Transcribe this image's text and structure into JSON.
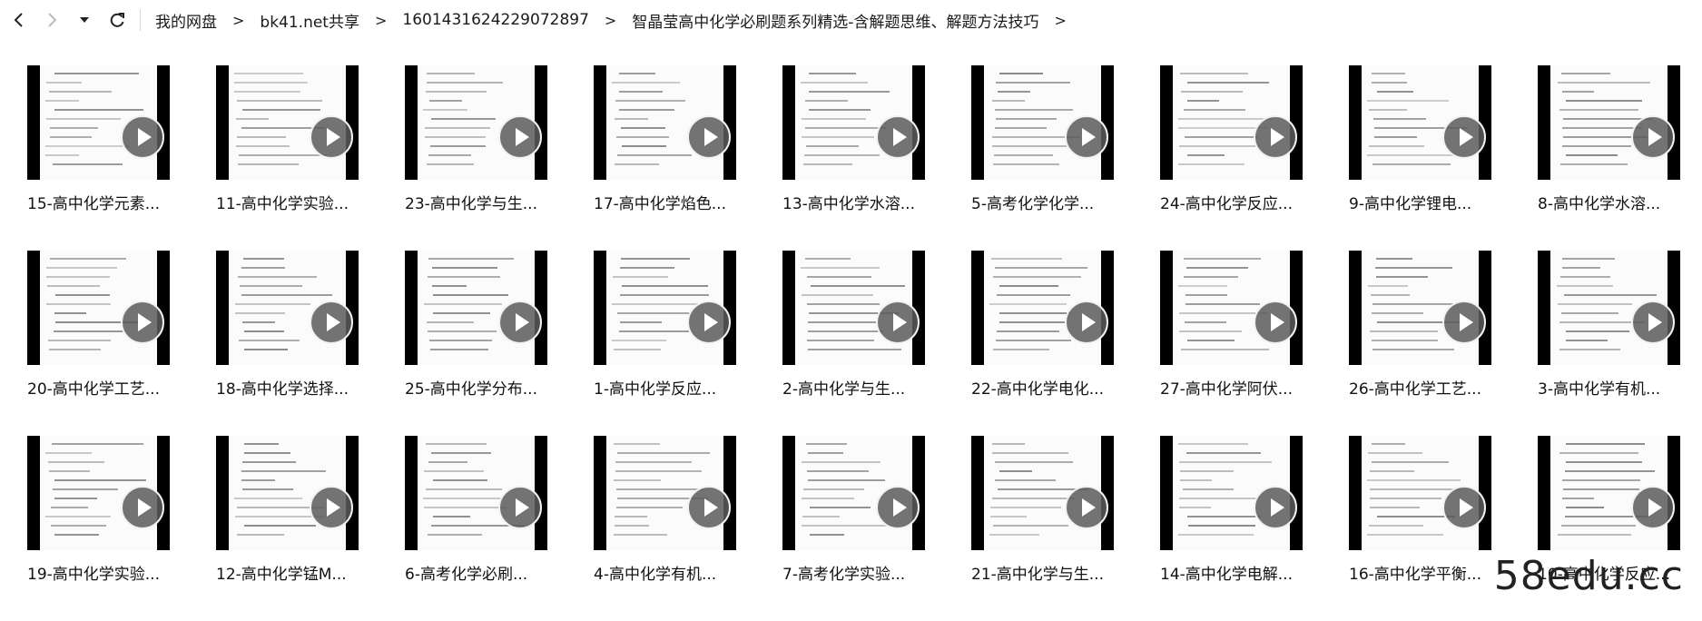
{
  "breadcrumb": [
    "我的网盘",
    "bk41.net共享",
    "1601431624229072897",
    "智晶莹高中化学必刷题系列精选-含解题思维、解题方法技巧"
  ],
  "breadcrumb_separator": ">",
  "files": [
    "15-高中化学元素...",
    "11-高中化学实验...",
    "23-高中化学与生...",
    "17-高中化学焰色...",
    "13-高中化学水溶...",
    "5-高考化学化学...",
    "24-高中化学反应...",
    "9-高中化学锂电...",
    "8-高中化学水溶...",
    "20-高中化学工艺...",
    "18-高中化学选择...",
    "25-高中化学分布...",
    "1-高中化学反应...",
    "2-高中化学与生...",
    "22-高中化学电化...",
    "27-高中化学阿伏...",
    "26-高中化学工艺...",
    "3-高中化学有机...",
    "19-高中化学实验...",
    "12-高中化学锰M...",
    "6-高考化学必刷...",
    "4-高中化学有机...",
    "7-高考化学实验...",
    "21-高中化学与生...",
    "14-高中化学电解...",
    "16-高中化学平衡...",
    "10-高中化学反应..."
  ],
  "watermark": "58edu.cc"
}
